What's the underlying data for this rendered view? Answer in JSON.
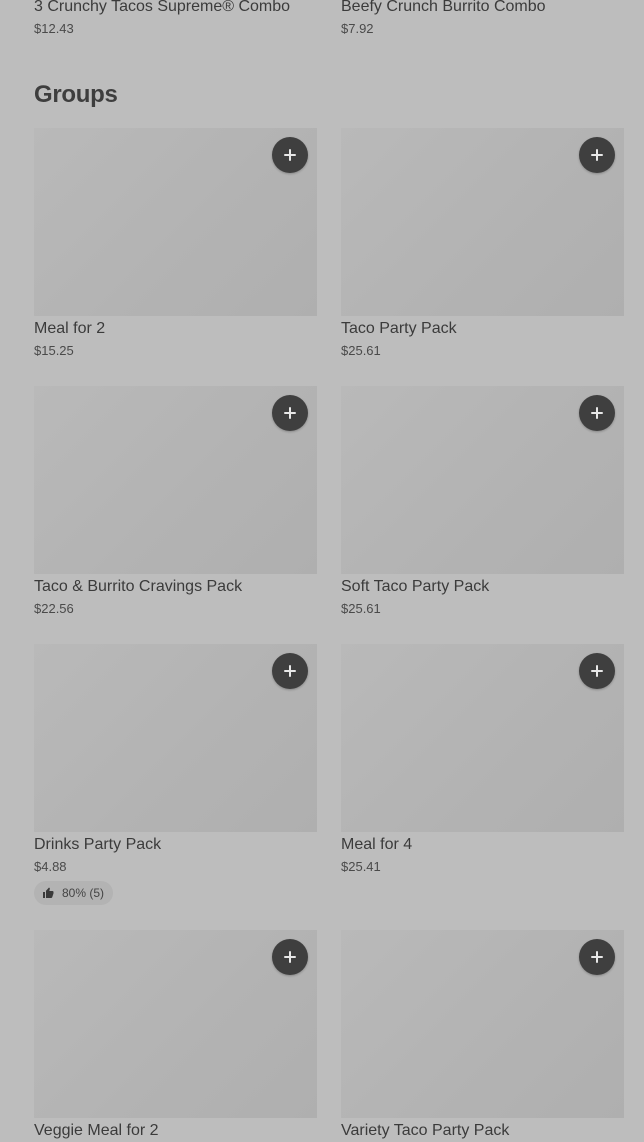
{
  "top_items": [
    {
      "name": "3 Crunchy Tacos Supreme® Combo",
      "price": "$12.43"
    },
    {
      "name": "Beefy Crunch Burrito Combo",
      "price": "$7.92"
    }
  ],
  "section": {
    "title": "Groups"
  },
  "cards": [
    {
      "name": "Meal for 2",
      "price": "$15.25",
      "add_icon": "plus-icon"
    },
    {
      "name": "Taco Party Pack",
      "price": "$25.61",
      "add_icon": "plus-icon"
    },
    {
      "name": "Taco & Burrito Cravings Pack",
      "price": "$22.56",
      "add_icon": "plus-icon"
    },
    {
      "name": "Soft Taco Party Pack",
      "price": "$25.61",
      "add_icon": "plus-icon"
    },
    {
      "name": "Drinks Party Pack",
      "price": "$4.88",
      "rating": "80% (5)",
      "rating_icon": "thumbs-up-icon",
      "add_icon": "plus-icon"
    },
    {
      "name": "Meal for 4",
      "price": "$25.41",
      "add_icon": "plus-icon"
    },
    {
      "name": "Veggie Meal for 2",
      "price": "",
      "add_icon": "plus-icon"
    },
    {
      "name": "Variety Taco Party Pack",
      "price": "",
      "add_icon": "plus-icon"
    }
  ],
  "colors": {
    "background": "#bdbdbd",
    "image_placeholder": "#b5b5b5",
    "add_button": "#3f3f3f",
    "text": "#3b3b3b"
  }
}
